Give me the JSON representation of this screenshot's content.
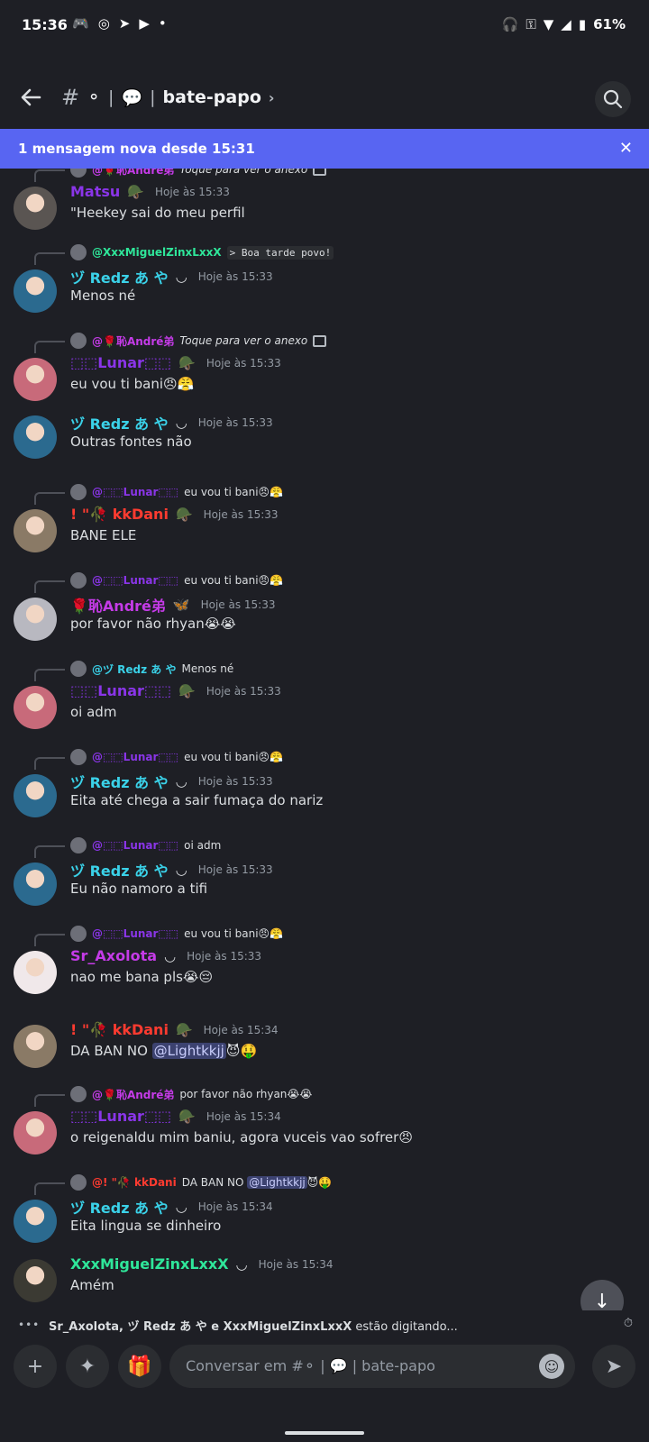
{
  "status_bar": {
    "time": "15:36",
    "app_icons": [
      "discord-icon",
      "whatsapp-icon",
      "telegram-icon",
      "youtube-icon"
    ],
    "dot": "•",
    "battery": "61%"
  },
  "header": {
    "hash": "#",
    "channel_emoji": "💬",
    "channel_circle": "⚬",
    "sep": "|",
    "channel_name": "bate-papo",
    "chevron": "›"
  },
  "banner": {
    "text": "1 mensagem nova desde 15:31",
    "close": "✕"
  },
  "colors": {
    "blurple": "#5865f2",
    "name_purple": "#8a35e8",
    "name_cyan": "#3ad1e8",
    "name_red": "#ff3b30",
    "name_green": "#2fe69a",
    "name_magenta": "#c53be8"
  },
  "messages": [
    {
      "reply": {
        "name": "@🌹恥André弟",
        "text": "Toque para ver o anexo",
        "italic": true,
        "image_icon": true,
        "name_color": "#c53be8"
      },
      "user": "Matsu",
      "name_color": "#8a35e8",
      "badge": "🪖",
      "time": "Hoje às 15:33",
      "text": "\"Heekey sai do meu perfil",
      "avatar_color": "#5a5552"
    },
    {
      "reply": {
        "name": "@XxxMiguelZinxLxxX",
        "text": "> Boa tarde povo!",
        "mono": true,
        "name_color": "#2fe69a"
      },
      "user": "ヅ Redz あ や",
      "name_color": "#3ad1e8",
      "badge": "◡",
      "time": "Hoje às 15:33",
      "text": "Menos né",
      "avatar_color": "#2b6a8f"
    },
    {
      "reply": {
        "name": "@🌹恥André弟",
        "text": "Toque para ver o anexo",
        "italic": true,
        "image_icon": true,
        "name_color": "#c53be8"
      },
      "user": "⬚⬚Lunar⬚⬚",
      "name_color": "#8a35e8",
      "badge": "🪖",
      "time": "Hoje às 15:33",
      "text": "eu vou ti bani😠😤",
      "avatar_color": "#c86a7a"
    },
    {
      "reply": null,
      "user": "ヅ Redz あ や",
      "name_color": "#3ad1e8",
      "badge": "◡",
      "time": "Hoje às 15:33",
      "text": "Outras fontes não",
      "avatar_color": "#2b6a8f"
    },
    {
      "reply": {
        "name": "@⬚⬚Lunar⬚⬚",
        "text": "eu vou ti bani😠😤",
        "name_color": "#8a35e8"
      },
      "user": "! \"🥀 kkDani",
      "name_color": "#ff3b30",
      "badge": "🪖",
      "time": "Hoje às 15:33",
      "text": "BANE ELE",
      "avatar_color": "#8a7a66"
    },
    {
      "reply": {
        "name": "@⬚⬚Lunar⬚⬚",
        "text": "eu vou ti bani😠😤",
        "name_color": "#8a35e8"
      },
      "user": "🌹恥André弟",
      "name_color": "#c53be8",
      "badge": "🦋",
      "time": "Hoje às 15:33",
      "text": "por favor não rhyan😭😭",
      "avatar_color": "#b8b8c0"
    },
    {
      "reply": {
        "name": "@ヅ Redz あ や",
        "text": "Menos né",
        "name_color": "#3ad1e8"
      },
      "user": "⬚⬚Lunar⬚⬚",
      "name_color": "#8a35e8",
      "badge": "🪖",
      "time": "Hoje às 15:33",
      "text": "oi adm",
      "avatar_color": "#c86a7a"
    },
    {
      "reply": {
        "name": "@⬚⬚Lunar⬚⬚",
        "text": "eu vou ti bani😠😤",
        "name_color": "#8a35e8"
      },
      "user": "ヅ Redz あ や",
      "name_color": "#3ad1e8",
      "badge": "◡",
      "time": "Hoje às 15:33",
      "text": "Eita até chega a sair fumaça do nariz",
      "avatar_color": "#2b6a8f"
    },
    {
      "reply": {
        "name": "@⬚⬚Lunar⬚⬚",
        "text": "oi adm",
        "name_color": "#8a35e8"
      },
      "user": "ヅ Redz あ や",
      "name_color": "#3ad1e8",
      "badge": "◡",
      "time": "Hoje às 15:33",
      "text": "Eu não namoro a tifi",
      "avatar_color": "#2b6a8f"
    },
    {
      "reply": {
        "name": "@⬚⬚Lunar⬚⬚",
        "text": "eu vou ti bani😠😤",
        "name_color": "#8a35e8"
      },
      "user": "Sr_Axolota",
      "name_color": "#c53be8",
      "badge": "◡",
      "time": "Hoje às 15:33",
      "text": "nao me bana pls😭😔",
      "avatar_color": "#f0e8ea"
    },
    {
      "reply": null,
      "user": "! \"🥀 kkDani",
      "name_color": "#ff3b30",
      "badge": "🪖",
      "time": "Hoje às 15:34",
      "text_before": "DA BAN NO ",
      "mention": "@Lightkkjj",
      "text_after": "😈🤑",
      "avatar_color": "#8a7a66"
    },
    {
      "reply": {
        "name": "@🌹恥André弟",
        "text": "por favor não rhyan😭😭",
        "name_color": "#c53be8"
      },
      "user": "⬚⬚Lunar⬚⬚",
      "name_color": "#8a35e8",
      "badge": "🪖",
      "time": "Hoje às 15:34",
      "text": "o reigenaldu mim baniu, agora vuceis vao sofrer😠",
      "avatar_color": "#c86a7a"
    },
    {
      "reply": {
        "name": "@! \"🥀 kkDani",
        "text_before": "DA BAN NO ",
        "mention": "@Lightkkjj",
        "text_after": "😈🤑",
        "name_color": "#ff3b30"
      },
      "user": "ヅ Redz あ や",
      "name_color": "#3ad1e8",
      "badge": "◡",
      "time": "Hoje às 15:34",
      "text": "Eita lingua se dinheiro",
      "avatar_color": "#2b6a8f"
    },
    {
      "reply": null,
      "user": "XxxMiguelZinxLxxX",
      "name_color": "#2fe69a",
      "badge": "◡",
      "time": "Hoje às 15:34",
      "text": "Amém",
      "avatar_color": "#3b3a33"
    }
  ],
  "typing": {
    "dots": "•••",
    "users": "Sr_Axolota, ヅ Redz あ や e XxxMiguelZinxLxxX",
    "suffix": " estão digitando..."
  },
  "composer": {
    "placeholder": "Conversar em #⚬ | 💬 | bate-papo",
    "plus": "+",
    "apps": "✦",
    "gift": "🎁",
    "emoji": "☺",
    "send": "➤"
  },
  "scroll_down": "↓"
}
